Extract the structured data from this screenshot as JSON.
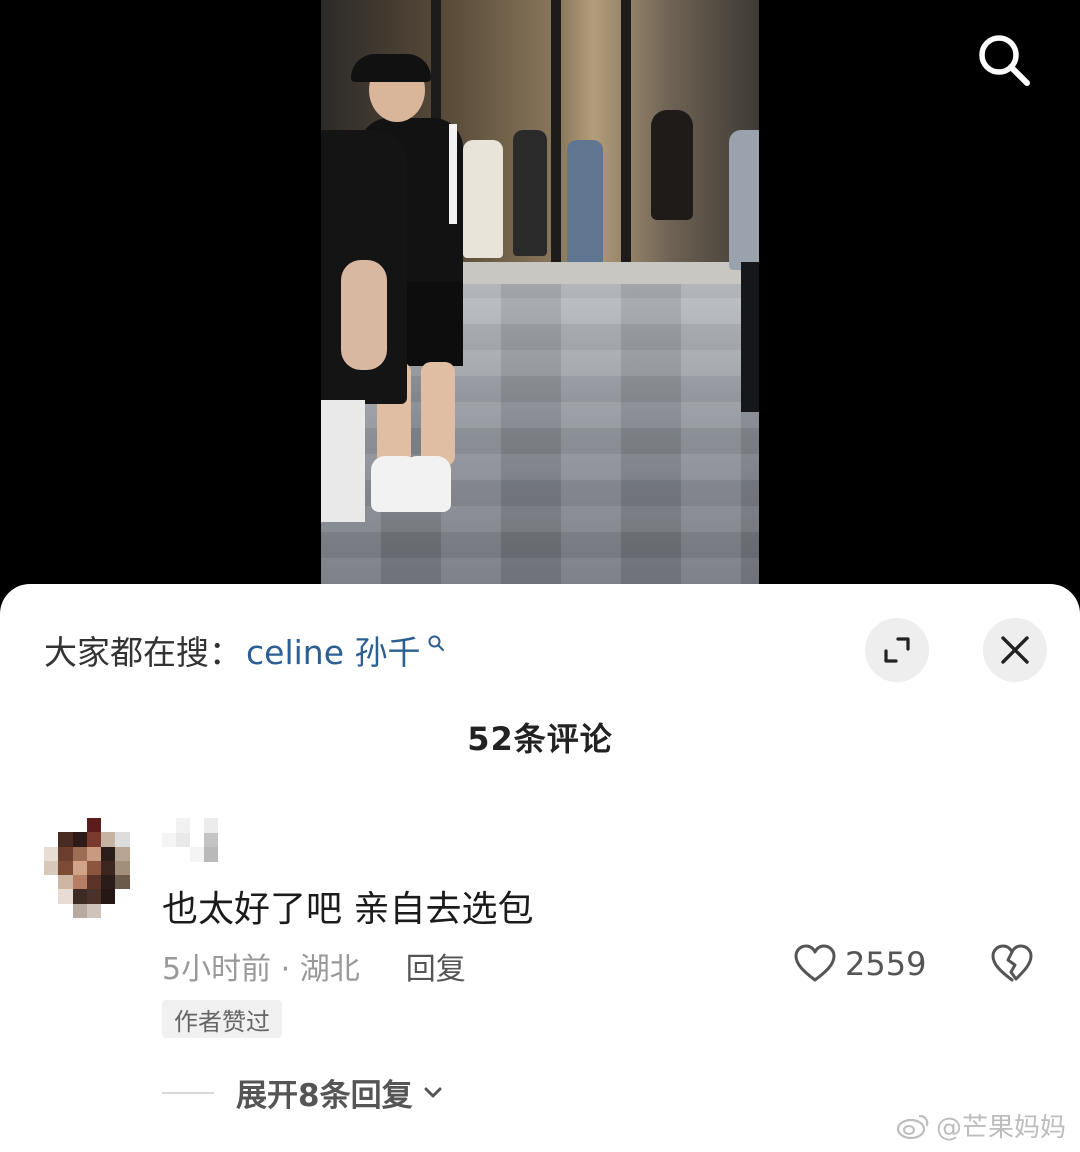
{
  "header": {
    "trending_label": "大家都在搜：",
    "trending_query": "celine 孙千"
  },
  "comments": {
    "title": "52条评论",
    "items": [
      {
        "text": "也太好了吧 亲自去选包",
        "time_location": "5小时前 · 湖北",
        "reply_label": "回复",
        "like_count": "2559",
        "badge": "作者赞过",
        "expand_replies_label": "展开8条回复"
      }
    ]
  },
  "watermark": "@芒果妈妈",
  "icons": {
    "search": "search-icon",
    "expand": "expand-icon",
    "close": "close-icon",
    "like": "heart-icon",
    "dislike": "broken-heart-icon",
    "chevron": "chevron-down-icon"
  },
  "colors": {
    "link": "#2c5f93",
    "sheet_bg": "#ffffff",
    "button_bg": "#eeeeef"
  }
}
